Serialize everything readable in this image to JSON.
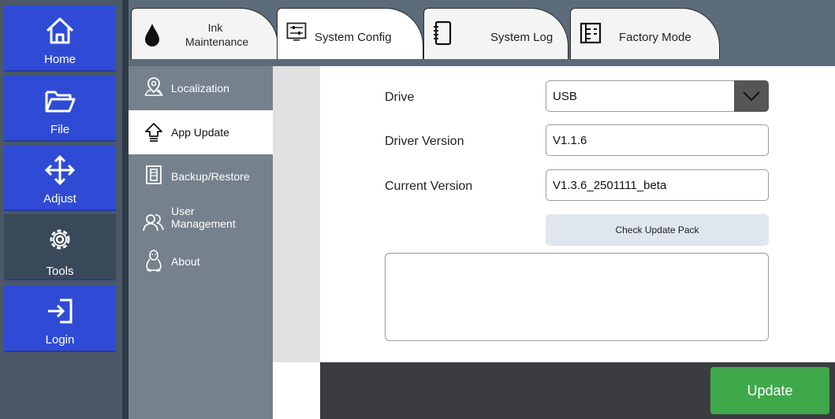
{
  "left_nav": {
    "items": [
      {
        "label": "Home",
        "icon": "home-icon"
      },
      {
        "label": "File",
        "icon": "folder-icon"
      },
      {
        "label": "Adjust",
        "icon": "move-icon"
      },
      {
        "label": "Tools",
        "icon": "gear-icon",
        "active": true
      },
      {
        "label": "Login",
        "icon": "login-icon"
      }
    ]
  },
  "tabs": [
    {
      "label_line1": "Ink",
      "label_line2": "Maintenance",
      "icon": "ink-drop-icon"
    },
    {
      "label": "System Config",
      "icon": "sliders-icon",
      "active": true
    },
    {
      "label": "System Log",
      "icon": "notebook-icon"
    },
    {
      "label": "Factory Mode",
      "icon": "factory-icon"
    }
  ],
  "sub_nav": {
    "items": [
      {
        "label": "Localization",
        "icon": "location-pin-icon"
      },
      {
        "label": "App Update",
        "icon": "upload-arrow-icon",
        "active": true
      },
      {
        "label": "Backup/Restore",
        "icon": "backup-icon"
      },
      {
        "label_line1": "User",
        "label_line2": "Management",
        "icon": "users-icon"
      },
      {
        "label": "About",
        "icon": "linux-icon"
      }
    ]
  },
  "form": {
    "drive_label": "Drive",
    "drive_value": "USB",
    "driver_version_label": "Driver Version",
    "driver_version_value": "V1.1.6",
    "current_version_label": "Current Version",
    "current_version_value": "V1.3.6_2501111_beta",
    "check_button": "Check Update Pack",
    "log_text": ""
  },
  "update_button": "Update",
  "colors": {
    "nav_blue": "#2f4bd6",
    "nav_active": "#394959",
    "subnav_gray": "#75818c",
    "bottom_bar": "#3b3c40",
    "update_green": "#3ea84b",
    "check_button_bg": "#dfe6ef"
  }
}
